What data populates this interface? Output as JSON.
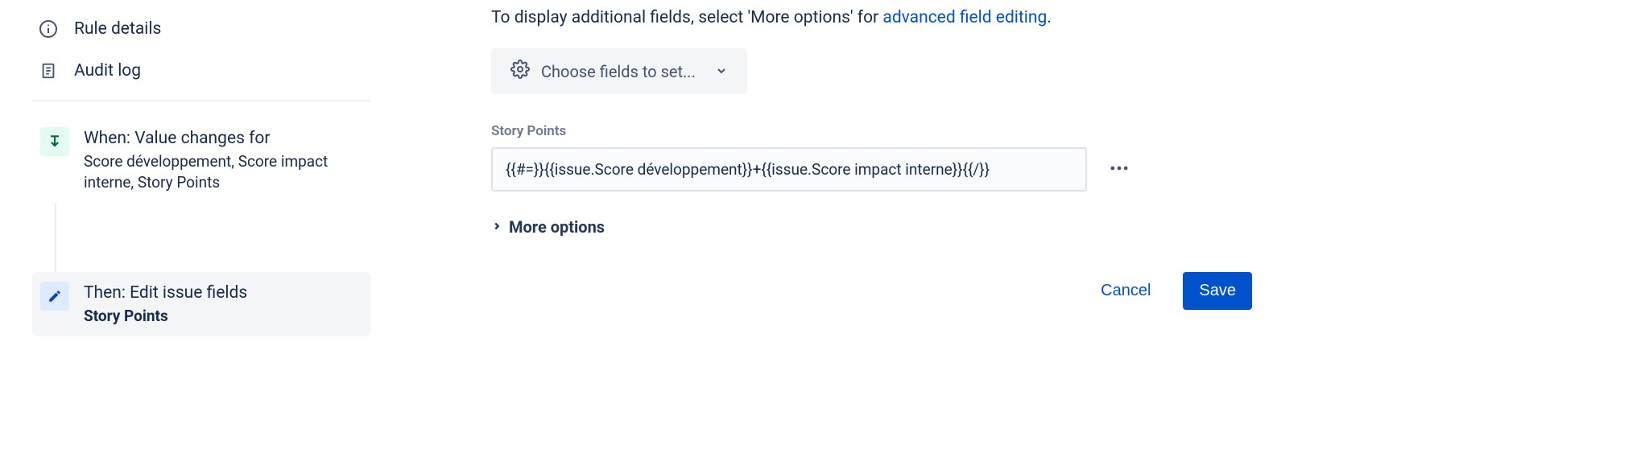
{
  "sidebar": {
    "rule_details": "Rule details",
    "audit_log": "Audit log",
    "trigger": {
      "title": "When: Value changes for",
      "sub": "Score développement, Score impact interne, Story Points"
    },
    "action": {
      "title": "Then: Edit issue fields",
      "sub": "Story Points"
    }
  },
  "main": {
    "instruction_prefix": "To display additional fields, select 'More options' for ",
    "instruction_link": "advanced field editing",
    "instruction_suffix": ".",
    "fields_dropdown": "Choose fields to set...",
    "field_label": "Story Points",
    "field_value": "{{#=}}{{issue.Score développement}}+{{issue.Score impact interne}}{{/}}",
    "more_options": "More options",
    "cancel": "Cancel",
    "save": "Save"
  }
}
